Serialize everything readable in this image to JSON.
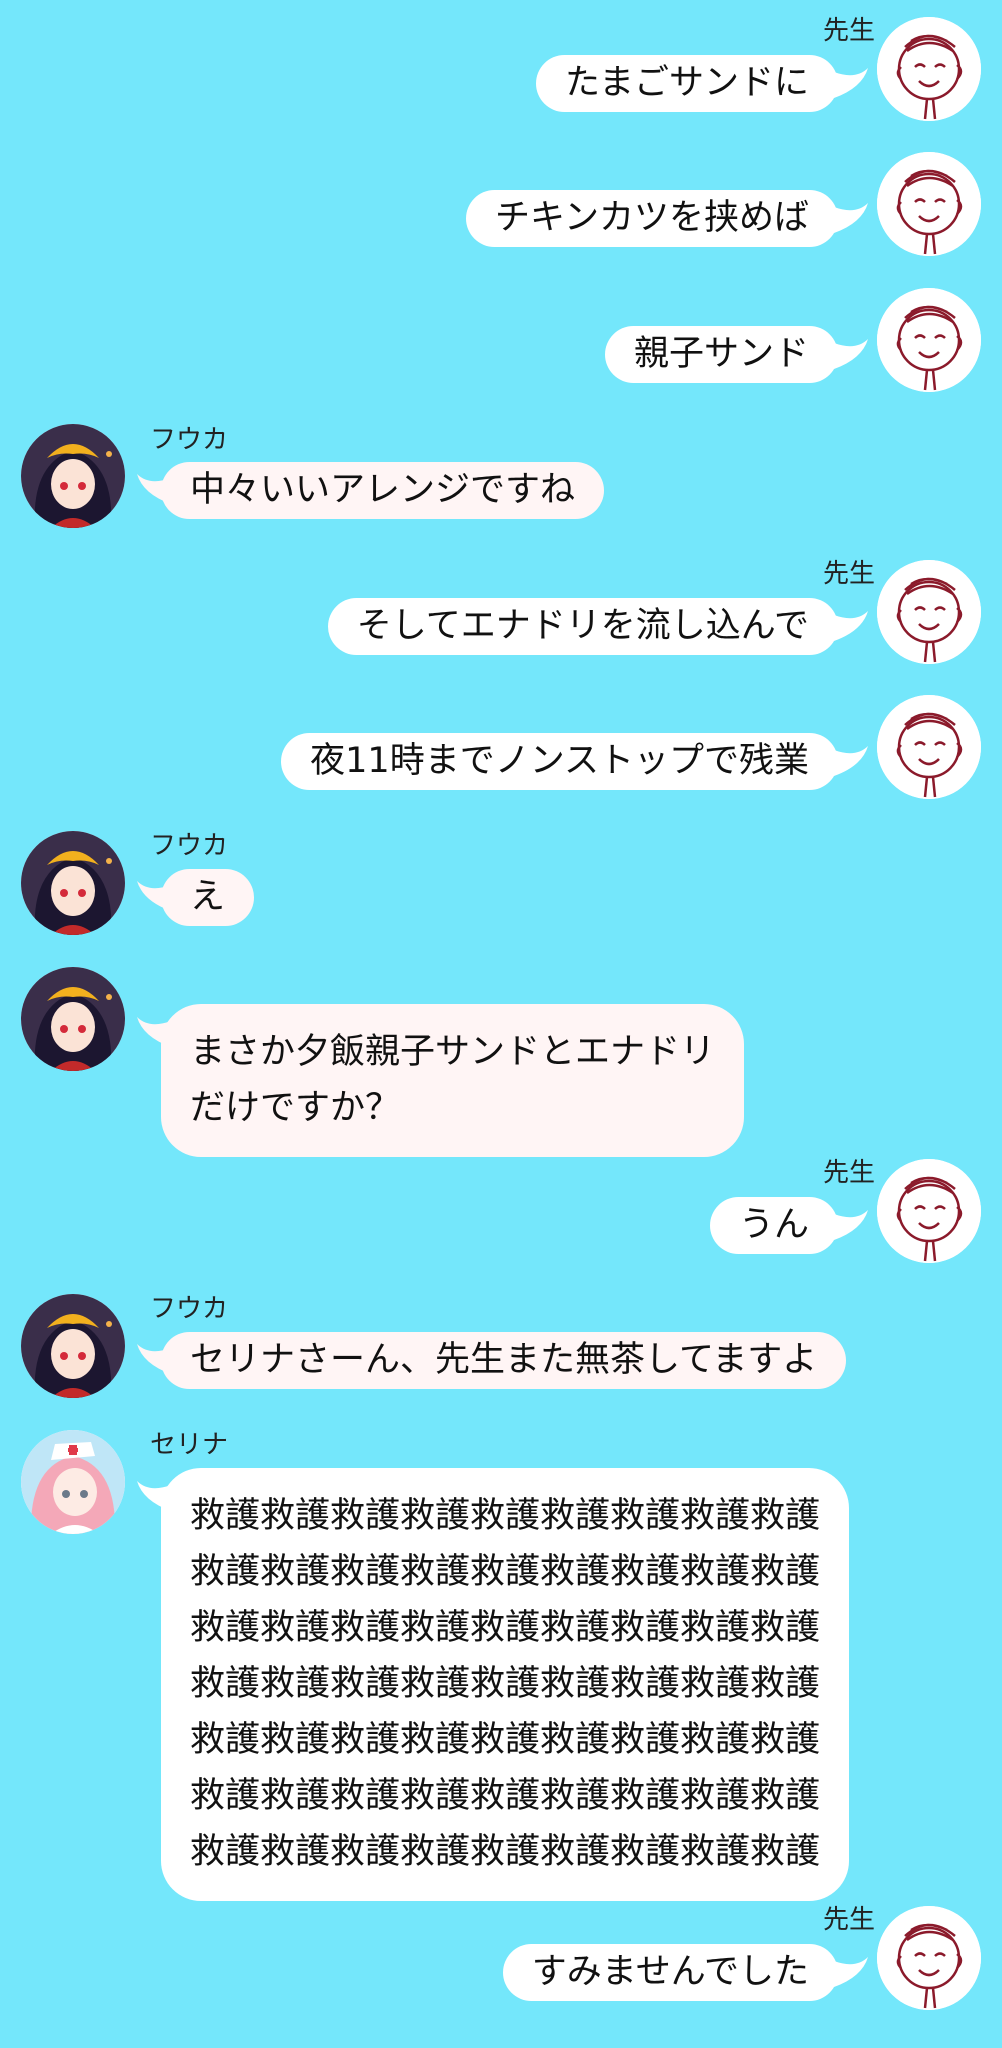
{
  "chat": {
    "messages": [
      {
        "sender": "先生",
        "side": "right",
        "lines": [
          "たまごサンドに"
        ]
      },
      {
        "sender": "",
        "side": "right",
        "lines": [
          "チキンカツを挟めば"
        ]
      },
      {
        "sender": "",
        "side": "right",
        "lines": [
          "親子サンド"
        ]
      },
      {
        "sender": "フウカ",
        "side": "left",
        "lines": [
          "中々いいアレンジですね"
        ]
      },
      {
        "sender": "先生",
        "side": "right",
        "lines": [
          "そしてエナドリを流し込んで"
        ]
      },
      {
        "sender": "",
        "side": "right",
        "lines": [
          "夜11時までノンストップで残業"
        ]
      },
      {
        "sender": "フウカ",
        "side": "left",
        "lines": [
          "え"
        ]
      },
      {
        "sender": "",
        "side": "left",
        "lines": [
          "まさか夕飯親子サンドとエナドリ",
          "だけですか？"
        ]
      },
      {
        "sender": "先生",
        "side": "right",
        "lines": [
          "うん"
        ]
      },
      {
        "sender": "フウカ",
        "side": "left",
        "lines": [
          "セリナさーん、先生また無茶してますよ"
        ]
      },
      {
        "sender": "セリナ",
        "side": "left",
        "lines": [
          "救護救護救護救護救護救護救護救護救護",
          "救護救護救護救護救護救護救護救護救護",
          "救護救護救護救護救護救護救護救護救護",
          "救護救護救護救護救護救護救護救護救護",
          "救護救護救護救護救護救護救護救護救護",
          "救護救護救護救護救護救護救護救護救護",
          "救護救護救護救護救護救護救護救護救護"
        ]
      },
      {
        "sender": "先生",
        "side": "right",
        "lines": [
          "すみませんでした"
        ]
      }
    ]
  },
  "colors": {
    "background": "#74e7fb",
    "bubble_right": "#ffffff",
    "bubble_left": "#fff5f5"
  },
  "avatars": {
    "sensei": "doodle-face-icon",
    "fuuka": "fuuka-avatar-icon",
    "serina": "serina-avatar-icon"
  }
}
